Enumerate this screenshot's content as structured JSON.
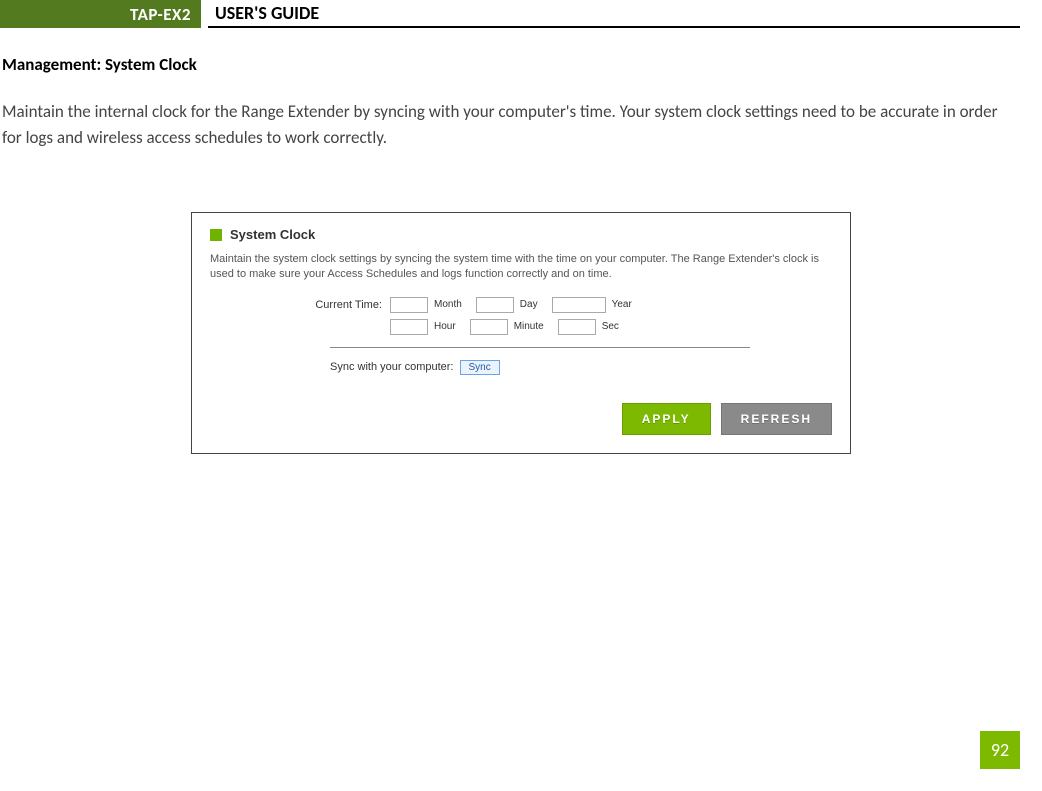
{
  "header": {
    "badge": "TAP-EX2",
    "title": "USER'S GUIDE"
  },
  "section_heading": "Management: System Clock",
  "body_paragraph": "Maintain the internal clock for the Range Extender by syncing with your computer's time. Your system clock settings need to be accurate in order for logs and wireless access schedules to work correctly.",
  "panel": {
    "title": "System Clock",
    "description": "Maintain the system clock settings by syncing the system time with the time on your computer. The Range Extender's clock is used to make sure your Access Schedules and logs function correctly and on time.",
    "current_time_label": "Current Time:",
    "fields": {
      "month_label": "Month",
      "day_label": "Day",
      "year_label": "Year",
      "hour_label": "Hour",
      "minute_label": "Minute",
      "sec_label": "Sec"
    },
    "sync_label": "Sync with your computer:",
    "sync_button": "Sync",
    "apply_button": "APPLY",
    "refresh_button": "REFRESH"
  },
  "page_number": "92"
}
